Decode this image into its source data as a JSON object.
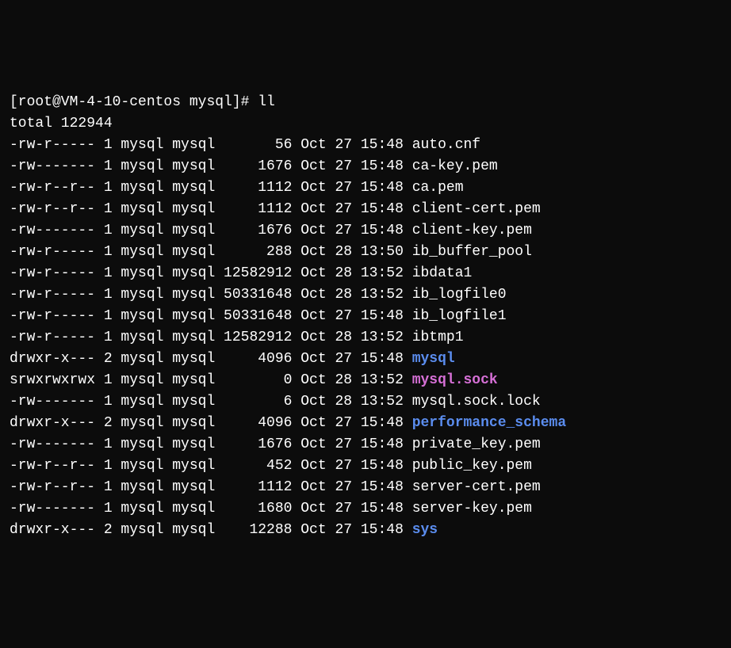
{
  "prompt": "[root@VM-4-10-centos mysql]# ll",
  "total": "total 122944",
  "rows": [
    {
      "perms": "-rw-r-----",
      "links": "1",
      "owner": "mysql",
      "group": "mysql",
      "size": "56",
      "date": "Oct 27 15:48",
      "name": "auto.cnf",
      "cls": ""
    },
    {
      "perms": "-rw-------",
      "links": "1",
      "owner": "mysql",
      "group": "mysql",
      "size": "1676",
      "date": "Oct 27 15:48",
      "name": "ca-key.pem",
      "cls": ""
    },
    {
      "perms": "-rw-r--r--",
      "links": "1",
      "owner": "mysql",
      "group": "mysql",
      "size": "1112",
      "date": "Oct 27 15:48",
      "name": "ca.pem",
      "cls": ""
    },
    {
      "perms": "-rw-r--r--",
      "links": "1",
      "owner": "mysql",
      "group": "mysql",
      "size": "1112",
      "date": "Oct 27 15:48",
      "name": "client-cert.pem",
      "cls": ""
    },
    {
      "perms": "-rw-------",
      "links": "1",
      "owner": "mysql",
      "group": "mysql",
      "size": "1676",
      "date": "Oct 27 15:48",
      "name": "client-key.pem",
      "cls": ""
    },
    {
      "perms": "-rw-r-----",
      "links": "1",
      "owner": "mysql",
      "group": "mysql",
      "size": "288",
      "date": "Oct 28 13:50",
      "name": "ib_buffer_pool",
      "cls": ""
    },
    {
      "perms": "-rw-r-----",
      "links": "1",
      "owner": "mysql",
      "group": "mysql",
      "size": "12582912",
      "date": "Oct 28 13:52",
      "name": "ibdata1",
      "cls": ""
    },
    {
      "perms": "-rw-r-----",
      "links": "1",
      "owner": "mysql",
      "group": "mysql",
      "size": "50331648",
      "date": "Oct 28 13:52",
      "name": "ib_logfile0",
      "cls": ""
    },
    {
      "perms": "-rw-r-----",
      "links": "1",
      "owner": "mysql",
      "group": "mysql",
      "size": "50331648",
      "date": "Oct 27 15:48",
      "name": "ib_logfile1",
      "cls": ""
    },
    {
      "perms": "-rw-r-----",
      "links": "1",
      "owner": "mysql",
      "group": "mysql",
      "size": "12582912",
      "date": "Oct 28 13:52",
      "name": "ibtmp1",
      "cls": ""
    },
    {
      "perms": "drwxr-x---",
      "links": "2",
      "owner": "mysql",
      "group": "mysql",
      "size": "4096",
      "date": "Oct 27 15:48",
      "name": "mysql",
      "cls": "dir"
    },
    {
      "perms": "srwxrwxrwx",
      "links": "1",
      "owner": "mysql",
      "group": "mysql",
      "size": "0",
      "date": "Oct 28 13:52",
      "name": "mysql.sock",
      "cls": "sock"
    },
    {
      "perms": "-rw-------",
      "links": "1",
      "owner": "mysql",
      "group": "mysql",
      "size": "6",
      "date": "Oct 28 13:52",
      "name": "mysql.sock.lock",
      "cls": ""
    },
    {
      "perms": "drwxr-x---",
      "links": "2",
      "owner": "mysql",
      "group": "mysql",
      "size": "4096",
      "date": "Oct 27 15:48",
      "name": "performance_schema",
      "cls": "dir"
    },
    {
      "perms": "-rw-------",
      "links": "1",
      "owner": "mysql",
      "group": "mysql",
      "size": "1676",
      "date": "Oct 27 15:48",
      "name": "private_key.pem",
      "cls": ""
    },
    {
      "perms": "-rw-r--r--",
      "links": "1",
      "owner": "mysql",
      "group": "mysql",
      "size": "452",
      "date": "Oct 27 15:48",
      "name": "public_key.pem",
      "cls": ""
    },
    {
      "perms": "-rw-r--r--",
      "links": "1",
      "owner": "mysql",
      "group": "mysql",
      "size": "1112",
      "date": "Oct 27 15:48",
      "name": "server-cert.pem",
      "cls": ""
    },
    {
      "perms": "-rw-------",
      "links": "1",
      "owner": "mysql",
      "group": "mysql",
      "size": "1680",
      "date": "Oct 27 15:48",
      "name": "server-key.pem",
      "cls": ""
    },
    {
      "perms": "drwxr-x---",
      "links": "2",
      "owner": "mysql",
      "group": "mysql",
      "size": "12288",
      "date": "Oct 27 15:48",
      "name": "sys",
      "cls": "dir"
    }
  ]
}
